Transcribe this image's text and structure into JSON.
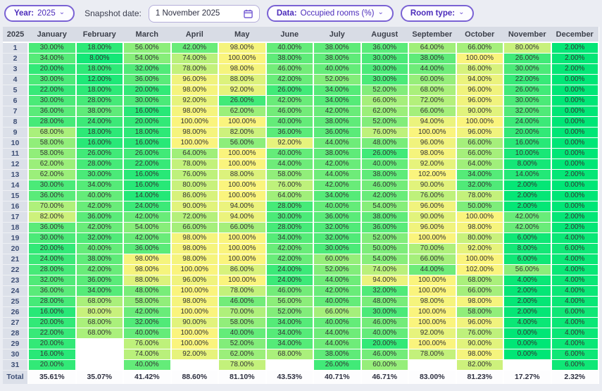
{
  "toolbar": {
    "year_label": "Year:",
    "year_value": "2025",
    "snapshot_label": "Snapshot date:",
    "snapshot_value": "1 November 2025",
    "data_label": "Data:",
    "data_value": "Occupied rooms (%)",
    "room_type_label": "Room type:",
    "chevron": "⌄"
  },
  "colors": {
    "heat_low": "#00e676",
    "heat_high": "#faf47d",
    "accent_purple": "#4c2cbb"
  },
  "table": {
    "year_header": "2025",
    "months": [
      "January",
      "February",
      "March",
      "April",
      "May",
      "June",
      "July",
      "August",
      "September",
      "October",
      "November",
      "December"
    ],
    "total_label": "Total",
    "rows": [
      {
        "day": "1",
        "values": [
          30,
          18,
          56,
          42,
          98,
          40,
          38,
          36,
          64,
          66,
          80,
          2
        ]
      },
      {
        "day": "2",
        "values": [
          34,
          8,
          54,
          74,
          100,
          38,
          38,
          30,
          38,
          100,
          26,
          2
        ]
      },
      {
        "day": "3",
        "values": [
          20,
          18,
          32,
          78,
          98,
          46,
          40,
          30,
          44,
          86,
          30,
          2
        ]
      },
      {
        "day": "4",
        "values": [
          30,
          12,
          36,
          96,
          88,
          42,
          52,
          30,
          60,
          94,
          22,
          0
        ]
      },
      {
        "day": "5",
        "values": [
          22,
          18,
          20,
          98,
          92,
          26,
          34,
          52,
          68,
          96,
          26,
          0
        ]
      },
      {
        "day": "6",
        "values": [
          30,
          28,
          30,
          92,
          26,
          42,
          34,
          66,
          72,
          96,
          30,
          0
        ]
      },
      {
        "day": "7",
        "values": [
          36,
          38,
          16,
          98,
          62,
          46,
          42,
          62,
          66,
          90,
          32,
          0
        ]
      },
      {
        "day": "8",
        "values": [
          28,
          24,
          20,
          100,
          100,
          40,
          38,
          52,
          94,
          100,
          24,
          0
        ]
      },
      {
        "day": "9",
        "values": [
          68,
          18,
          18,
          98,
          82,
          36,
          36,
          76,
          100,
          96,
          20,
          0
        ]
      },
      {
        "day": "10",
        "values": [
          58,
          16,
          16,
          100,
          56,
          92,
          44,
          48,
          96,
          66,
          16,
          0
        ]
      },
      {
        "day": "11",
        "values": [
          58,
          26,
          26,
          64,
          100,
          40,
          38,
          26,
          98,
          66,
          10,
          0
        ]
      },
      {
        "day": "12",
        "values": [
          62,
          28,
          22,
          78,
          100,
          44,
          42,
          40,
          92,
          64,
          8,
          0
        ]
      },
      {
        "day": "13",
        "values": [
          62,
          30,
          16,
          76,
          88,
          58,
          44,
          38,
          102,
          34,
          14,
          2
        ]
      },
      {
        "day": "14",
        "values": [
          30,
          34,
          16,
          80,
          100,
          76,
          42,
          46,
          90,
          32,
          2,
          0
        ]
      },
      {
        "day": "15",
        "values": [
          36,
          40,
          14,
          86,
          100,
          64,
          34,
          42,
          76,
          78,
          2,
          0
        ]
      },
      {
        "day": "16",
        "values": [
          70,
          42,
          24,
          90,
          94,
          28,
          40,
          54,
          96,
          50,
          2,
          0
        ]
      },
      {
        "day": "17",
        "values": [
          82,
          36,
          42,
          72,
          94,
          30,
          36,
          38,
          90,
          100,
          42,
          2
        ]
      },
      {
        "day": "18",
        "values": [
          36,
          42,
          54,
          66,
          66,
          28,
          32,
          36,
          96,
          98,
          42,
          2
        ]
      },
      {
        "day": "19",
        "values": [
          30,
          32,
          42,
          98,
          100,
          34,
          32,
          52,
          100,
          80,
          6,
          4
        ]
      },
      {
        "day": "20",
        "values": [
          20,
          40,
          36,
          98,
          100,
          42,
          30,
          50,
          70,
          92,
          8,
          6
        ]
      },
      {
        "day": "21",
        "values": [
          24,
          38,
          98,
          98,
          100,
          42,
          60,
          54,
          66,
          100,
          6,
          4
        ]
      },
      {
        "day": "22",
        "values": [
          28,
          42,
          98,
          100,
          86,
          24,
          52,
          74,
          44,
          102,
          56,
          4
        ]
      },
      {
        "day": "23",
        "values": [
          32,
          36,
          88,
          96,
          100,
          24,
          44,
          94,
          100,
          68,
          4,
          4
        ]
      },
      {
        "day": "24",
        "values": [
          36,
          34,
          48,
          100,
          78,
          46,
          42,
          32,
          100,
          66,
          2,
          4
        ]
      },
      {
        "day": "25",
        "values": [
          28,
          68,
          58,
          98,
          46,
          56,
          40,
          48,
          98,
          98,
          2,
          4
        ]
      },
      {
        "day": "26",
        "values": [
          16,
          80,
          42,
          100,
          70,
          52,
          66,
          30,
          100,
          58,
          2,
          6
        ]
      },
      {
        "day": "27",
        "values": [
          20,
          68,
          32,
          90,
          58,
          34,
          40,
          46,
          100,
          96,
          4,
          4
        ]
      },
      {
        "day": "28",
        "values": [
          22,
          68,
          40,
          100,
          40,
          34,
          44,
          40,
          92,
          76,
          0,
          4
        ]
      },
      {
        "day": "29",
        "values": [
          20,
          null,
          76,
          100,
          52,
          34,
          44,
          20,
          100,
          90,
          0,
          4
        ]
      },
      {
        "day": "30",
        "values": [
          16,
          null,
          74,
          92,
          62,
          68,
          38,
          46,
          78,
          98,
          0,
          6
        ]
      },
      {
        "day": "31",
        "values": [
          20,
          null,
          40,
          null,
          78,
          null,
          26,
          60,
          null,
          82,
          null,
          6
        ]
      }
    ],
    "totals": [
      "35.61%",
      "35.07%",
      "41.42%",
      "88.60%",
      "81.10%",
      "43.53%",
      "40.71%",
      "46.71%",
      "83.00%",
      "81.23%",
      "17.27%",
      "2.32%"
    ]
  }
}
